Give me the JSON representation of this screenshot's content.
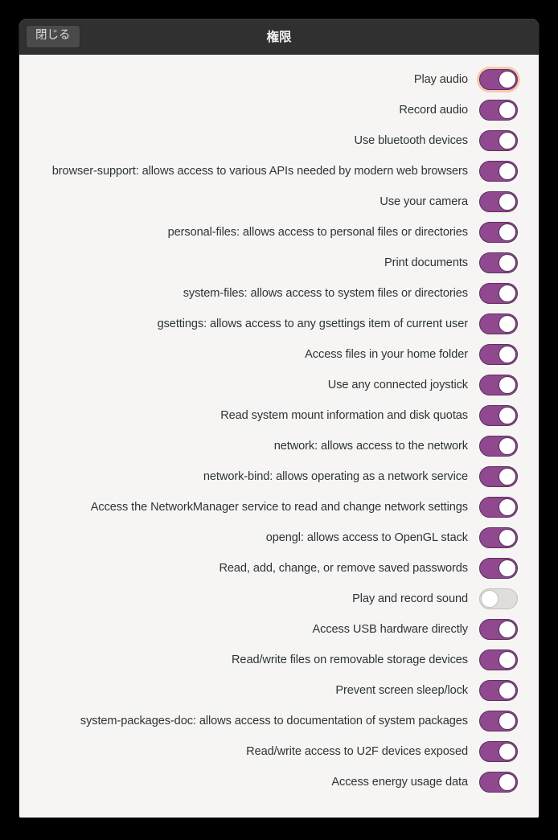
{
  "window": {
    "title": "権限",
    "close_label": "閉じる"
  },
  "colors": {
    "headerbar_bg": "#303030",
    "content_bg": "#f6f5f4",
    "switch_on": "#90488f",
    "switch_off": "#e0dedb",
    "focus_ring": "#f7c7b0",
    "label_text": "#2e3436"
  },
  "permissions": [
    {
      "label": "Play audio",
      "state": "on",
      "focused": true
    },
    {
      "label": "Record audio",
      "state": "on",
      "focused": false
    },
    {
      "label": "Use bluetooth devices",
      "state": "on",
      "focused": false
    },
    {
      "label": "browser-support: allows access to various APIs needed by modern web browsers",
      "state": "on",
      "focused": false
    },
    {
      "label": "Use your camera",
      "state": "on",
      "focused": false
    },
    {
      "label": "personal-files: allows access to personal files or directories",
      "state": "on",
      "focused": false
    },
    {
      "label": "Print documents",
      "state": "on",
      "focused": false
    },
    {
      "label": "system-files: allows access to system files or directories",
      "state": "on",
      "focused": false
    },
    {
      "label": "gsettings: allows access to any gsettings item of current user",
      "state": "on",
      "focused": false
    },
    {
      "label": "Access files in your home folder",
      "state": "on",
      "focused": false
    },
    {
      "label": "Use any connected joystick",
      "state": "on",
      "focused": false
    },
    {
      "label": "Read system mount information and disk quotas",
      "state": "on",
      "focused": false
    },
    {
      "label": "network: allows access to the network",
      "state": "on",
      "focused": false
    },
    {
      "label": "network-bind: allows operating as a network service",
      "state": "on",
      "focused": false
    },
    {
      "label": "Access the NetworkManager service to read and change network settings",
      "state": "on",
      "focused": false
    },
    {
      "label": "opengl: allows access to OpenGL stack",
      "state": "on",
      "focused": false
    },
    {
      "label": "Read, add, change, or remove saved passwords",
      "state": "on",
      "focused": false
    },
    {
      "label": "Play and record sound",
      "state": "off",
      "focused": false
    },
    {
      "label": "Access USB hardware directly",
      "state": "on",
      "focused": false
    },
    {
      "label": "Read/write files on removable storage devices",
      "state": "on",
      "focused": false
    },
    {
      "label": "Prevent screen sleep/lock",
      "state": "on",
      "focused": false
    },
    {
      "label": "system-packages-doc: allows access to documentation of system packages",
      "state": "on",
      "focused": false
    },
    {
      "label": "Read/write access to U2F devices exposed",
      "state": "on",
      "focused": false
    },
    {
      "label": "Access energy usage data",
      "state": "on",
      "focused": false
    }
  ]
}
